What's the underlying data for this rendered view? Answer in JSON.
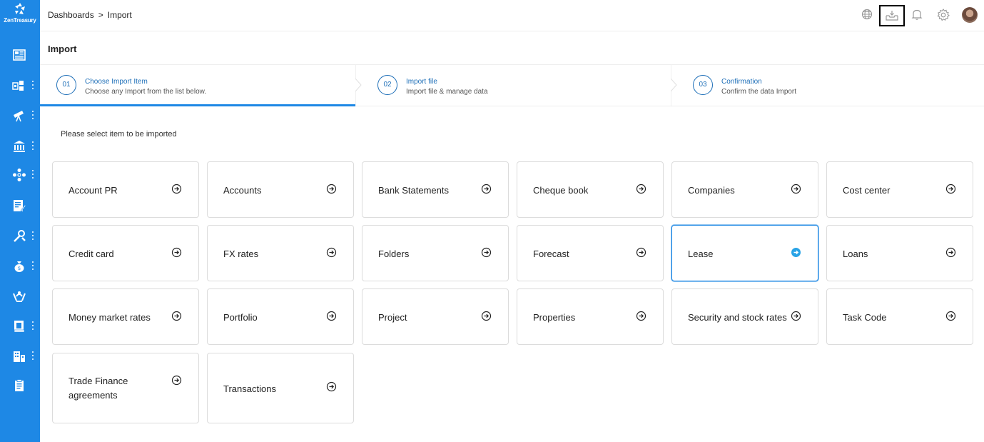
{
  "app": {
    "logo_text": "ZenTreasury"
  },
  "breadcrumb": {
    "root": "Dashboards",
    "separator": ">",
    "current": "Import"
  },
  "page": {
    "title": "Import",
    "prompt": "Please select item to be imported"
  },
  "header_icons": [
    "globe-icon",
    "inbox-download-icon",
    "bell-icon",
    "gear-icon",
    "avatar"
  ],
  "sidebar": {
    "items": [
      {
        "icon": "dashboard-icon",
        "has_menu": false
      },
      {
        "icon": "modules-icon",
        "has_menu": true
      },
      {
        "icon": "telescope-icon",
        "has_menu": true
      },
      {
        "icon": "bank-icon",
        "has_menu": true
      },
      {
        "icon": "network-icon",
        "has_menu": true
      },
      {
        "icon": "document-edit-icon",
        "has_menu": false
      },
      {
        "icon": "tools-icon",
        "has_menu": true
      },
      {
        "icon": "moneybag-icon",
        "has_menu": true
      },
      {
        "icon": "hands-icon",
        "has_menu": false
      },
      {
        "icon": "report-icon",
        "has_menu": true
      },
      {
        "icon": "buildings-icon",
        "has_menu": true
      },
      {
        "icon": "clipboard-icon",
        "has_menu": false
      }
    ]
  },
  "steps": [
    {
      "number": "01",
      "title": "Choose Import Item",
      "subtitle": "Choose any Import from the list below.",
      "active": true
    },
    {
      "number": "02",
      "title": "Import file",
      "subtitle": "Import file & manage data",
      "active": false
    },
    {
      "number": "03",
      "title": "Confirmation",
      "subtitle": "Confirm the data Import",
      "active": false
    }
  ],
  "import_items": [
    {
      "label": "Account PR"
    },
    {
      "label": "Accounts"
    },
    {
      "label": "Bank Statements"
    },
    {
      "label": "Cheque book"
    },
    {
      "label": "Companies"
    },
    {
      "label": "Cost center"
    },
    {
      "label": "Credit card"
    },
    {
      "label": "FX rates"
    },
    {
      "label": "Folders"
    },
    {
      "label": "Forecast"
    },
    {
      "label": "Lease",
      "selected": true
    },
    {
      "label": "Loans"
    },
    {
      "label": "Money market rates"
    },
    {
      "label": "Portfolio"
    },
    {
      "label": "Project"
    },
    {
      "label": "Properties"
    },
    {
      "label": "Security and stock rates"
    },
    {
      "label": "Task Code"
    },
    {
      "label": "Trade Finance agreements"
    },
    {
      "label": "Transactions"
    }
  ],
  "colors": {
    "sidebar": "#1e88e5",
    "accent": "#1e6fb8",
    "selected_border": "#1e88e5"
  }
}
